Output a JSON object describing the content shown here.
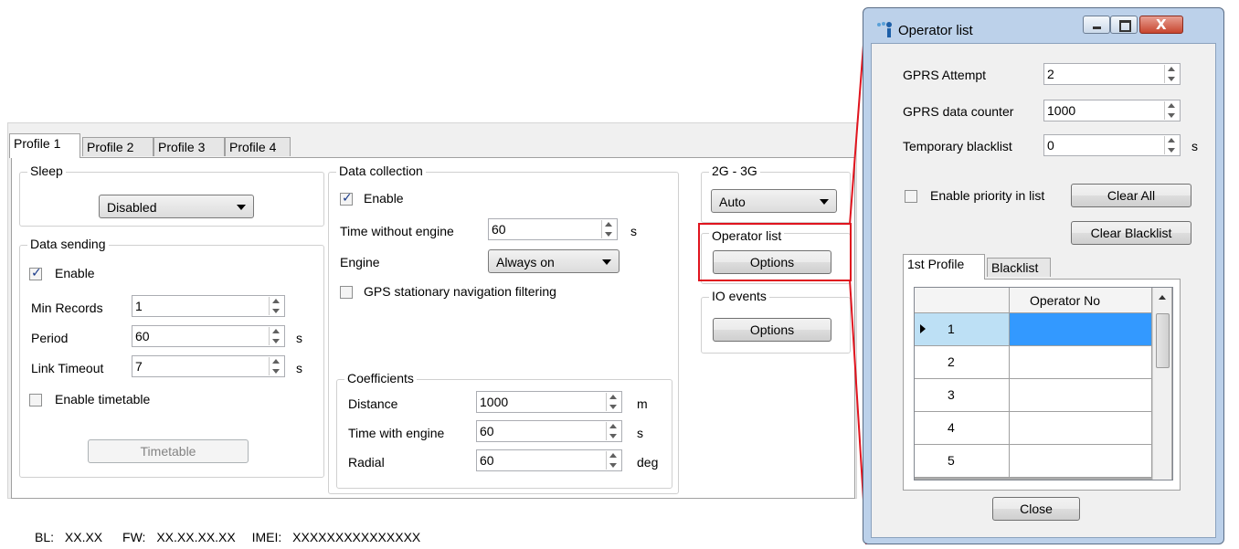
{
  "tabs": [
    "Profile 1",
    "Profile 2",
    "Profile 3",
    "Profile 4"
  ],
  "sleep": {
    "title": "Sleep",
    "mode": "Disabled"
  },
  "data_sending": {
    "title": "Data sending",
    "enable_label": "Enable",
    "enable_checked": true,
    "min_records_label": "Min Records",
    "min_records": "1",
    "period_label": "Period",
    "period": "60",
    "period_unit": "s",
    "link_timeout_label": "Link Timeout",
    "link_timeout": "7",
    "link_timeout_unit": "s",
    "timetable_label": "Enable timetable",
    "timetable_checked": false,
    "timetable_button": "Timetable"
  },
  "data_collection": {
    "title": "Data collection",
    "enable_label": "Enable",
    "enable_checked": true,
    "time_without_engine_label": "Time without engine",
    "time_without_engine": "60",
    "time_without_engine_unit": "s",
    "engine_label": "Engine",
    "engine_value": "Always on",
    "gps_filter_label": "GPS stationary navigation filtering",
    "gps_filter_checked": false
  },
  "coefficients": {
    "title": "Coefficients",
    "distance_label": "Distance",
    "distance": "1000",
    "distance_unit": "m",
    "time_with_engine_label": "Time with engine",
    "time_with_engine": "60",
    "time_with_engine_unit": "s",
    "radial_label": "Radial",
    "radial": "60",
    "radial_unit": "deg"
  },
  "network": {
    "title": "2G - 3G",
    "value": "Auto"
  },
  "operator_list": {
    "title": "Operator list",
    "button": "Options"
  },
  "io_events": {
    "title": "IO events",
    "button": "Options"
  },
  "status": {
    "bl_label": "BL:",
    "bl": "XX.XX",
    "fw_label": "FW:",
    "fw": "XX.XX.XX.XX",
    "imei_label": "IMEI:",
    "imei": "XXXXXXXXXXXXXXX"
  },
  "operator_window": {
    "title": "Operator list",
    "gprs_attempt_label": "GPRS Attempt",
    "gprs_attempt": "2",
    "gprs_counter_label": "GPRS data counter",
    "gprs_counter": "1000",
    "temp_blacklist_label": "Temporary blacklist",
    "temp_blacklist": "0",
    "temp_blacklist_unit": "s",
    "priority_label": "Enable priority in list",
    "priority_checked": false,
    "clear_all": "Clear All",
    "clear_blacklist": "Clear Blacklist",
    "tabs": [
      "1st Profile",
      "Blacklist"
    ],
    "grid_header": "Operator No",
    "rows": [
      "1",
      "2",
      "3",
      "4",
      "5"
    ],
    "close": "Close"
  },
  "colors": {
    "highlight": "#e0141e",
    "selected_cell": "#3399ff",
    "selected_row_header": "#bde0f5"
  }
}
